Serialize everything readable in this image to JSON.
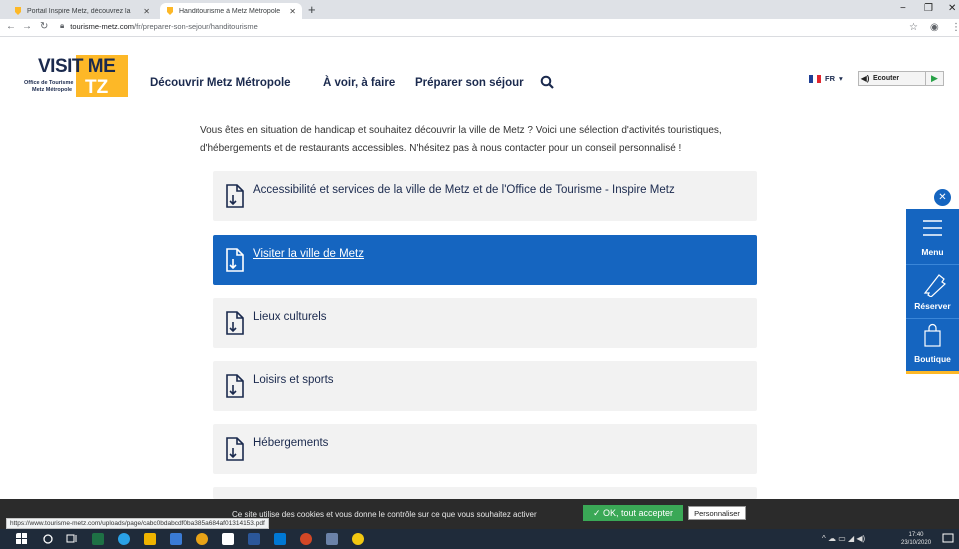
{
  "browser": {
    "tabs": [
      {
        "title": "Portail Inspire Metz, découvrez la",
        "favicon_color": "#fdb827"
      },
      {
        "title": "Handitourisme à Metz Métropole",
        "favicon_color": "#fdb827"
      }
    ],
    "url_domain": "tourisme-metz.com",
    "url_path": "/fr/preparer-son-sejour/handitourisme"
  },
  "site": {
    "logo": {
      "line1": "VISIT ME",
      "line2": "TZ",
      "sub1": "Office de Tourisme",
      "sub2": "Metz Métropole"
    },
    "nav": [
      "Découvrir Metz Métropole",
      "À voir, à faire",
      "Préparer son séjour"
    ],
    "lang": "FR",
    "listen_label": "Ecouter"
  },
  "intro": "Vous êtes en situation de handicap et souhaitez découvrir la ville de Metz ? Voici une sélection d'activités touristiques, d'hébergements et de restaurants accessibles. N'hésitez pas à nous contacter pour un conseil personnalisé !",
  "items": [
    "Accessibilité et services de la ville de Metz et de l'Office de Tourisme - Inspire Metz",
    "Visiter la ville de Metz",
    "Lieux culturels",
    "Loisirs et sports",
    "Hébergements"
  ],
  "sidebar": {
    "menu": "Menu",
    "reserver": "Réserver",
    "boutique": "Boutique"
  },
  "cookie": {
    "message": "Ce site utilise des cookies et vous donne le contrôle sur ce que vous souhaitez activer",
    "accept": "✓ OK, tout accepter",
    "customize": "Personnaliser"
  },
  "status_url": "https://www.tourisme-metz.com/uploads/page/cabc0bdabcdf0ba385a684af01314153.pdf",
  "clock": {
    "time": "17:40",
    "date": "23/10/2020"
  },
  "colors": {
    "brand_blue": "#1565c0",
    "brand_yellow": "#fdb827",
    "navy": "#1b2a4e",
    "accept_green": "#3aa856"
  }
}
